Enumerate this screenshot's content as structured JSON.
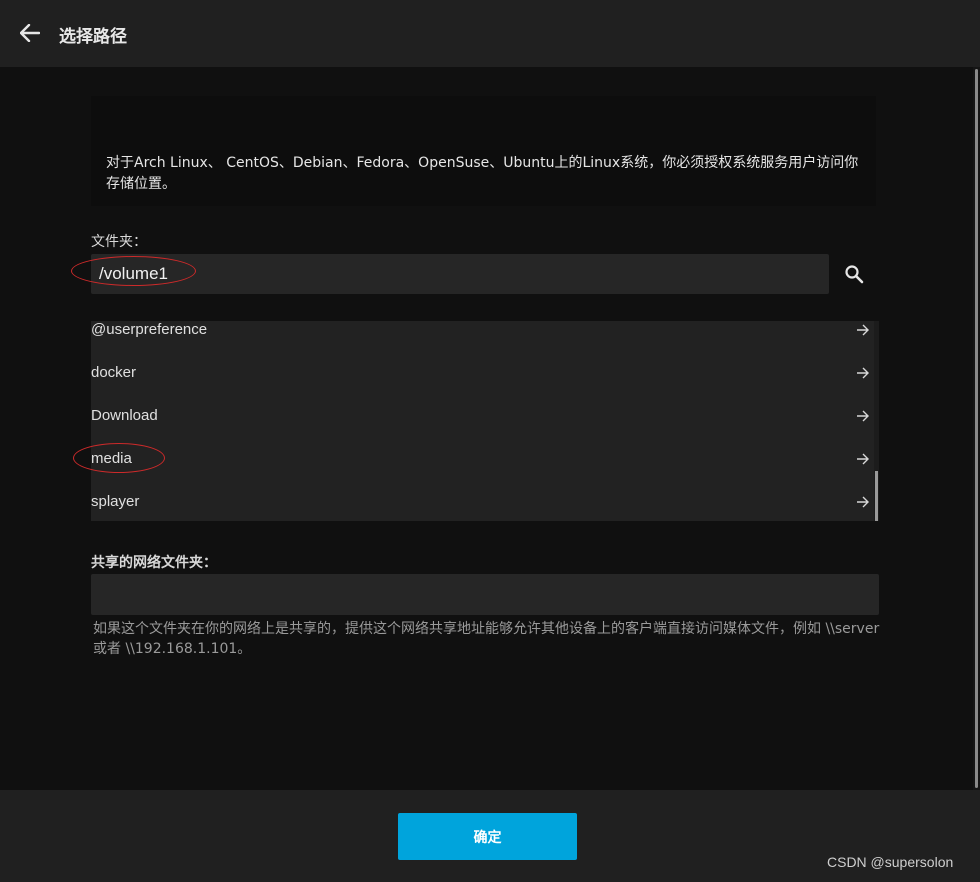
{
  "header": {
    "title": "选择路径",
    "back_icon": "arrow-left-icon"
  },
  "notice": {
    "text": "对于Arch Linux、 CentOS、Debian、Fedora、OpenSuse、Ubuntu上的Linux系统，你必须授权系统服务用户访问你存储位置。"
  },
  "folder": {
    "label": "文件夹：",
    "value": "/volume1",
    "search_icon": "search-icon"
  },
  "folder_list": {
    "items": [
      {
        "label": "@userpreference",
        "icon": "arrow-right-icon"
      },
      {
        "label": "docker",
        "icon": "arrow-right-icon"
      },
      {
        "label": "Download",
        "icon": "arrow-right-icon"
      },
      {
        "label": "media",
        "icon": "arrow-right-icon"
      },
      {
        "label": "splayer",
        "icon": "arrow-right-icon"
      }
    ]
  },
  "shared_folder": {
    "label": "共享的网络文件夹：",
    "value": "",
    "hint": "如果这个文件夹在你的网络上是共享的，提供这个网络共享地址能够允许其他设备上的客户端直接访问媒体文件，例如 \\\\server 或者 \\\\192.168.1.101。"
  },
  "footer": {
    "ok_label": "确定"
  },
  "watermark": "CSDN @supersolon",
  "colors": {
    "accent": "#00a4dc",
    "annotation": "#cc2a2a",
    "background": "#101010",
    "panel": "#202020"
  }
}
